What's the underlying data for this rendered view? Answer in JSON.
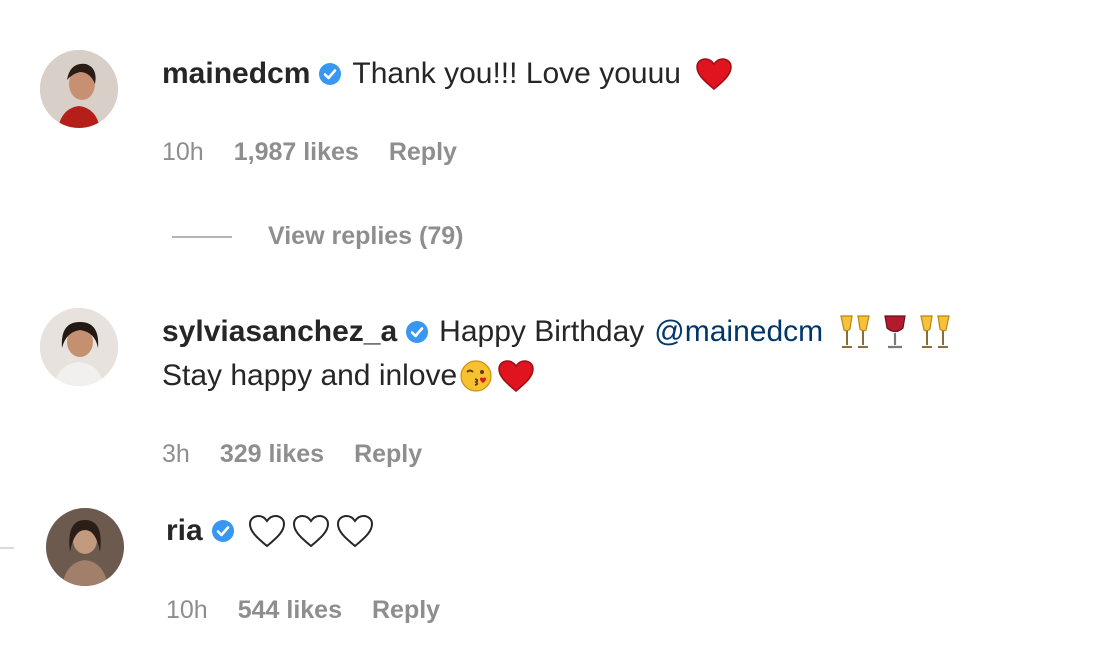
{
  "comments": [
    {
      "username": "mainedcm",
      "text": "Thank you!!! Love youuu",
      "emoji": "red-heart",
      "time": "10h",
      "likes": "1,987 likes",
      "reply_label": "Reply",
      "view_replies": "View replies (79)"
    },
    {
      "username": "sylviasanchez_a",
      "text": "Happy Birthday",
      "mention": "@mainedcm",
      "emojis_line1": [
        "clinking-glasses",
        "wine-glass",
        "clinking-glasses"
      ],
      "text2": "Stay happy and inlove",
      "emojis_line2": [
        "kissing-face",
        "red-heart"
      ],
      "time": "3h",
      "likes": "329 likes",
      "reply_label": "Reply"
    },
    {
      "username": "ria",
      "emojis": [
        "white-heart",
        "white-heart",
        "white-heart"
      ],
      "time": "10h",
      "likes": "544 likes",
      "reply_label": "Reply"
    }
  ],
  "colors": {
    "verified_blue": "#3897f0",
    "heart_red": "#e0141e",
    "meta_gray": "#8e8e8e",
    "mention_blue": "#00376b"
  }
}
